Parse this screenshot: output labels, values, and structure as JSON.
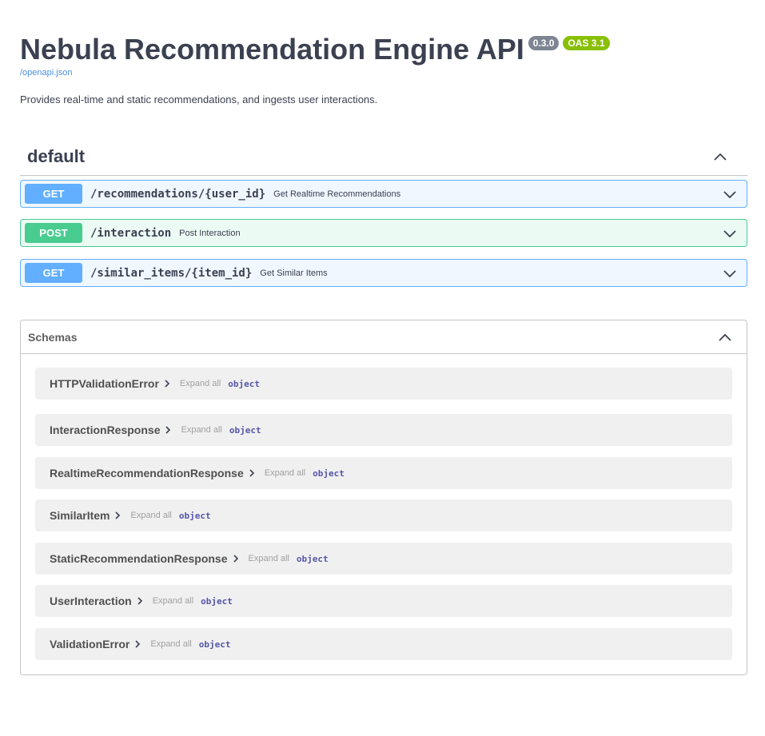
{
  "info": {
    "title": "Nebula Recommendation Engine API",
    "version": "0.3.0",
    "oas_version": "OAS 3.1",
    "spec_link": "/openapi.json",
    "description": "Provides real-time and static recommendations, and ingests user interactions."
  },
  "tag": {
    "name": "default",
    "chevron": "chevron-up-icon"
  },
  "operations": [
    {
      "method": "GET",
      "path": "/recommendations/{user_id}",
      "summary": "Get Realtime Recommendations",
      "color": "#61affe"
    },
    {
      "method": "POST",
      "path": "/interaction",
      "summary": "Post Interaction",
      "color": "#49cc90"
    },
    {
      "method": "GET",
      "path": "/similar_items/{item_id}",
      "summary": "Get Similar Items",
      "color": "#61affe"
    }
  ],
  "schemas": {
    "title": "Schemas",
    "expand_label": "Expand all",
    "items": [
      {
        "name": "HTTPValidationError",
        "type": "object"
      },
      {
        "name": "InteractionResponse",
        "type": "object"
      },
      {
        "name": "RealtimeRecommendationResponse",
        "type": "object"
      },
      {
        "name": "SimilarItem",
        "type": "object"
      },
      {
        "name": "StaticRecommendationResponse",
        "type": "object"
      },
      {
        "name": "UserInteraction",
        "type": "object"
      },
      {
        "name": "ValidationError",
        "type": "object"
      }
    ]
  }
}
